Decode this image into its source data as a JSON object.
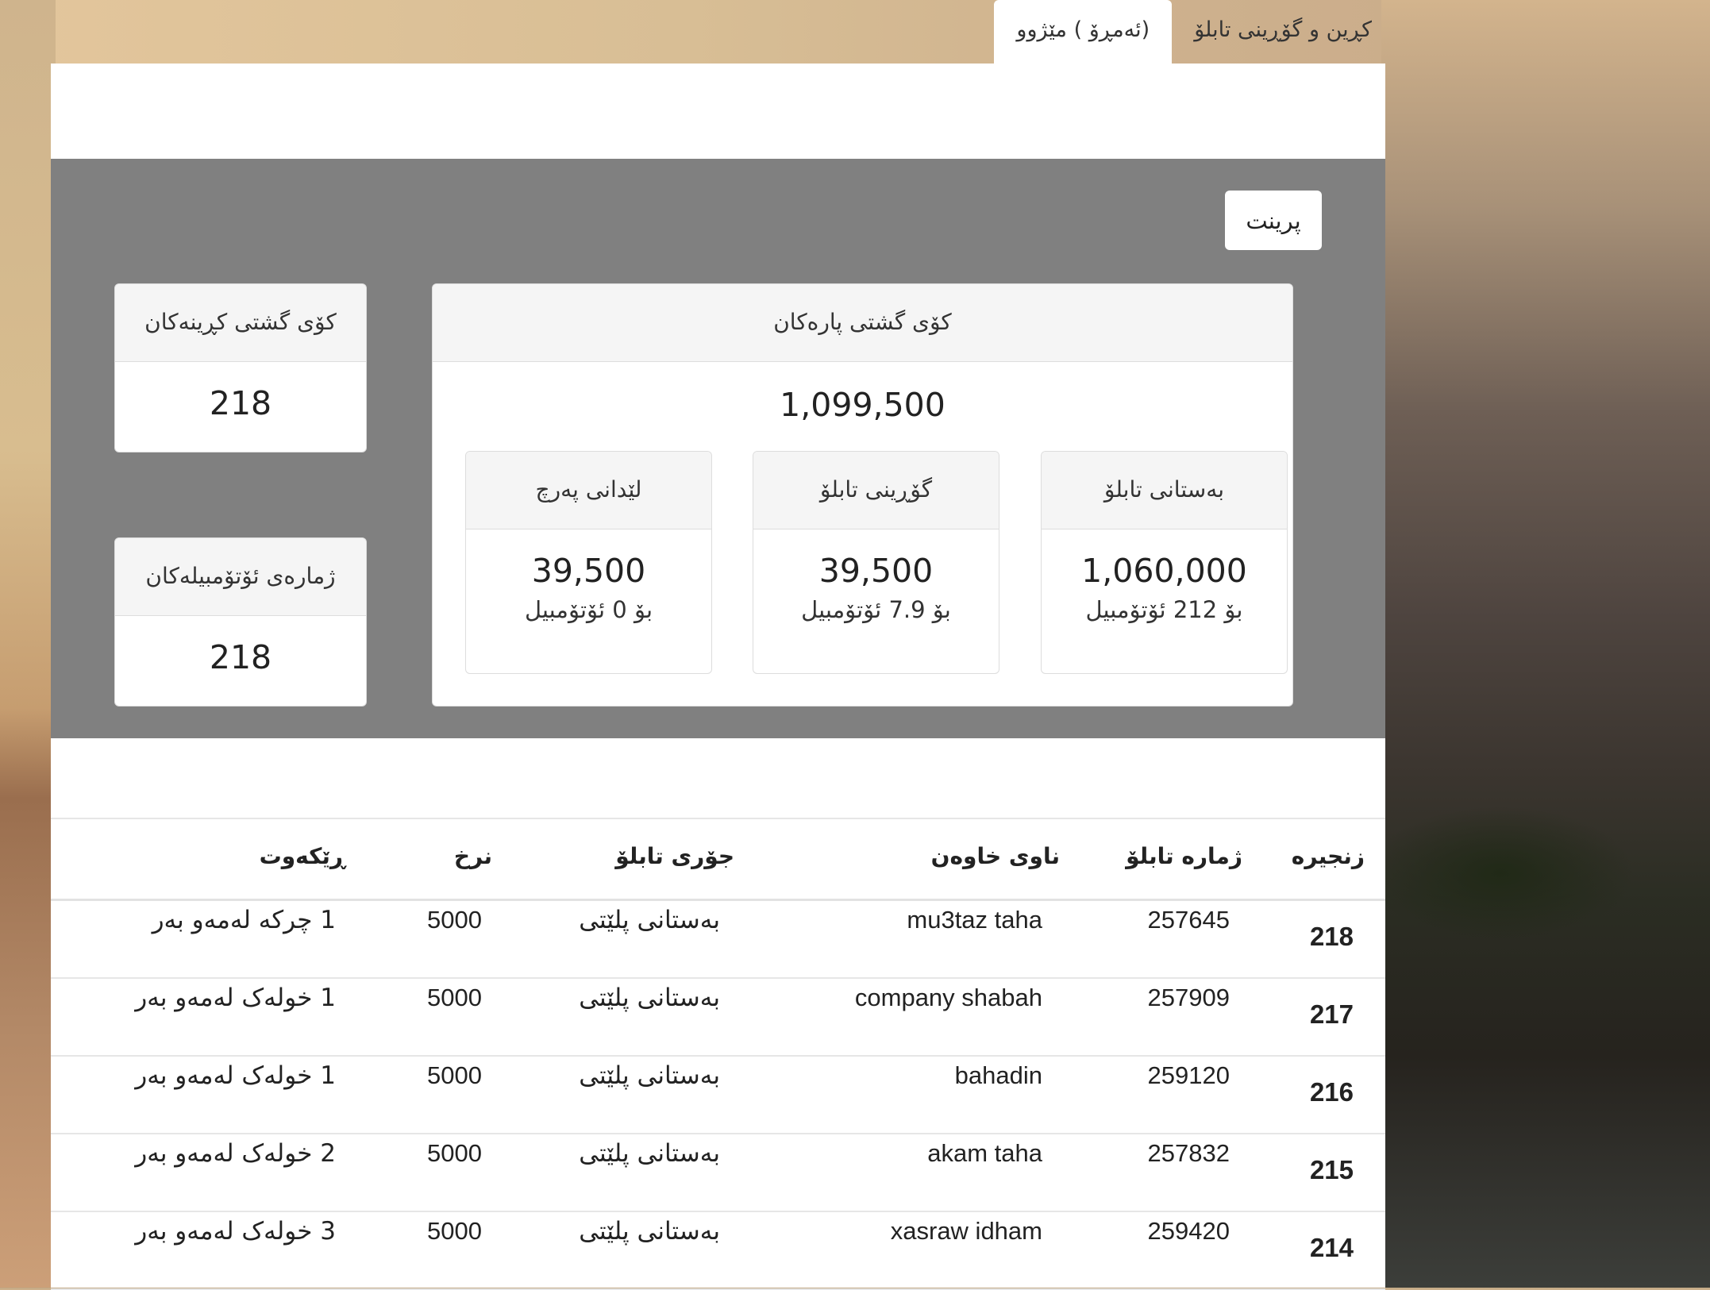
{
  "tabs": [
    {
      "label": "کڕین و گۆڕینی تابلۆ"
    },
    {
      "label": "(ئەمڕۆ ) مێژوو"
    }
  ],
  "print_button": "پرینت",
  "summary": {
    "total_money": {
      "title": "کۆی گشتی پارەکان",
      "value": "1,099,500"
    },
    "total_purchases": {
      "title": "کۆی گشتی کڕینەکان",
      "value": "218"
    },
    "car_count": {
      "title": "ژمارەی ئۆتۆمبیلەکان",
      "value": "218"
    },
    "boxes": [
      {
        "title": "بەستانی تابلۆ",
        "value": "1,060,000",
        "sub": "بۆ 212 ئۆتۆمبیل"
      },
      {
        "title": "گۆڕینی تابلۆ",
        "value": "39,500",
        "sub": "بۆ 7.9 ئۆتۆمبیل"
      },
      {
        "title": "لێدانی پەرچ",
        "value": "39,500",
        "sub": "بۆ 0 ئۆتۆمبیل"
      }
    ]
  },
  "table": {
    "headers": [
      "زنجیره",
      "ژماره تابلۆ",
      "ناوی خاوەن",
      "جۆری تابلۆ",
      "نرخ",
      "ڕێکەوت"
    ],
    "rows": [
      {
        "serial": "218",
        "plate": "257645",
        "owner": "mu3taz taha",
        "type": "بەستانی پلێتی",
        "price": "5000",
        "date": "1 چرکە لەمەو بەر"
      },
      {
        "serial": "217",
        "plate": "257909",
        "owner": "company shabah",
        "type": "بەستانی پلێتی",
        "price": "5000",
        "date": "1 خولەک لەمەو بەر"
      },
      {
        "serial": "216",
        "plate": "259120",
        "owner": "bahadin",
        "type": "بەستانی پلێتی",
        "price": "5000",
        "date": "1 خولەک لەمەو بەر"
      },
      {
        "serial": "215",
        "plate": "257832",
        "owner": "akam taha",
        "type": "بەستانی پلێتی",
        "price": "5000",
        "date": "2 خولەک لەمەو بەر"
      },
      {
        "serial": "214",
        "plate": "259420",
        "owner": "xasraw idham",
        "type": "بەستانی پلێتی",
        "price": "5000",
        "date": "3 خولەک لەمەو بەر"
      }
    ]
  }
}
